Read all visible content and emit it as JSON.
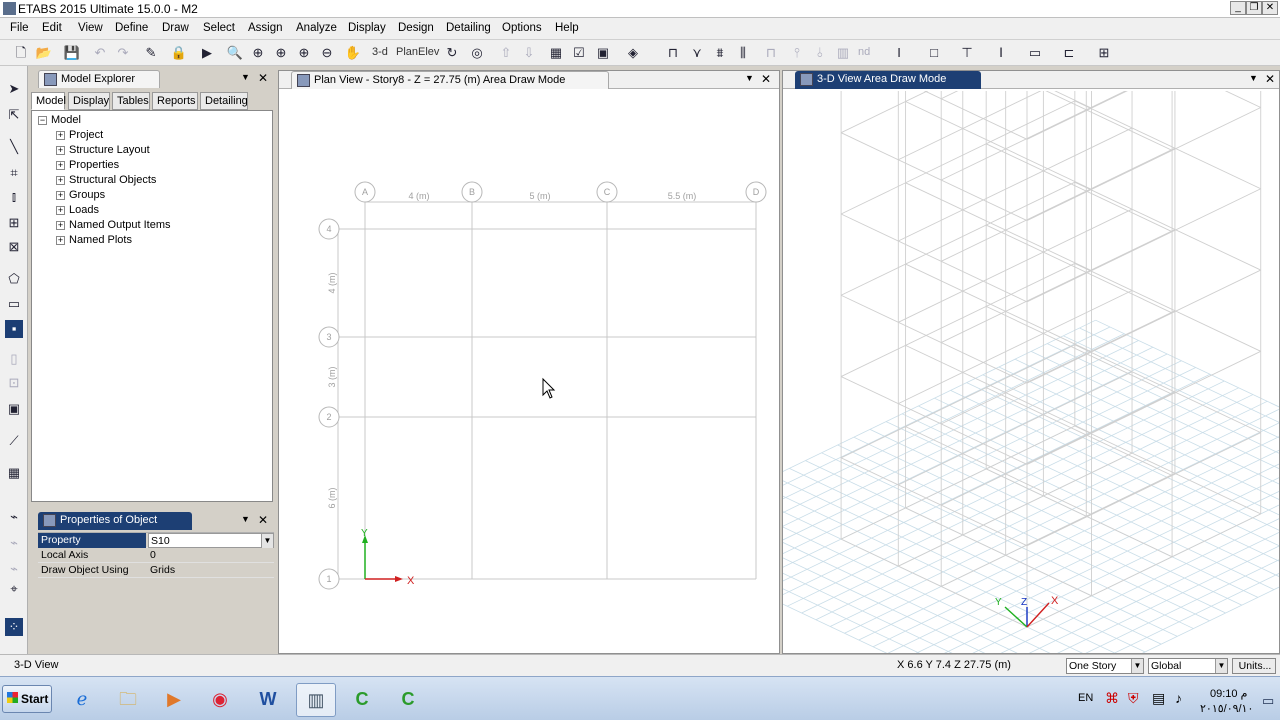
{
  "window": {
    "title": "ETABS 2015 Ultimate 15.0.0 - M2"
  },
  "menu": [
    "File",
    "Edit",
    "View",
    "Define",
    "Draw",
    "Select",
    "Assign",
    "Analyze",
    "Display",
    "Design",
    "Detailing",
    "Options",
    "Help"
  ],
  "toolbar": {
    "view_3d_label": "3-d",
    "plan_label": "Plan",
    "elev_label": "Elev",
    "nd_label": "nd"
  },
  "explorer": {
    "title": "Model Explorer",
    "tabs": [
      "Model",
      "Display",
      "Tables",
      "Reports",
      "Detailing"
    ],
    "root": "Model",
    "items": [
      "Project",
      "Structure Layout",
      "Properties",
      "Structural Objects",
      "Groups",
      "Loads",
      "Named Output Items",
      "Named Plots"
    ]
  },
  "props": {
    "title": "Properties of Object",
    "rows": [
      {
        "key": "Property",
        "value": "S10"
      },
      {
        "key": "Local Axis",
        "value": "0"
      },
      {
        "key": "Draw Object Using",
        "value": "Grids"
      }
    ]
  },
  "plan_view": {
    "title": "Plan View - Story8 - Z = 27.75 (m)  Area Draw Mode",
    "grid_x_labels": [
      "A",
      "B",
      "C",
      "D"
    ],
    "grid_y_labels": [
      "4",
      "3",
      "2",
      "1"
    ],
    "x_spacings": [
      "4 (m)",
      "5 (m)",
      "5.5 (m)"
    ],
    "y_spacings": [
      "4 (m)",
      "3 (m)",
      "6 (m)"
    ],
    "axis_x": "X",
    "axis_y": "Y"
  },
  "view_3d": {
    "title": "3-D View  Area Draw Mode",
    "axis_x": "X",
    "axis_y": "Y",
    "axis_z": "Z"
  },
  "status": {
    "left": "3-D View",
    "coords": "X 6.6  Y 7.4  Z 27.75 (m)",
    "story_select": "One Story",
    "coord_select": "Global",
    "units_button": "Units..."
  },
  "taskbar": {
    "start": "Start",
    "lang": "EN",
    "time": "09:10 م",
    "date": "٢٠١٥/٠٩/١٠"
  },
  "colors": {
    "accent": "#1d3f74",
    "grid_line": "#c8c8c8",
    "axis_x": "#d02020",
    "axis_y": "#20b020",
    "axis_z": "#1030c0"
  }
}
